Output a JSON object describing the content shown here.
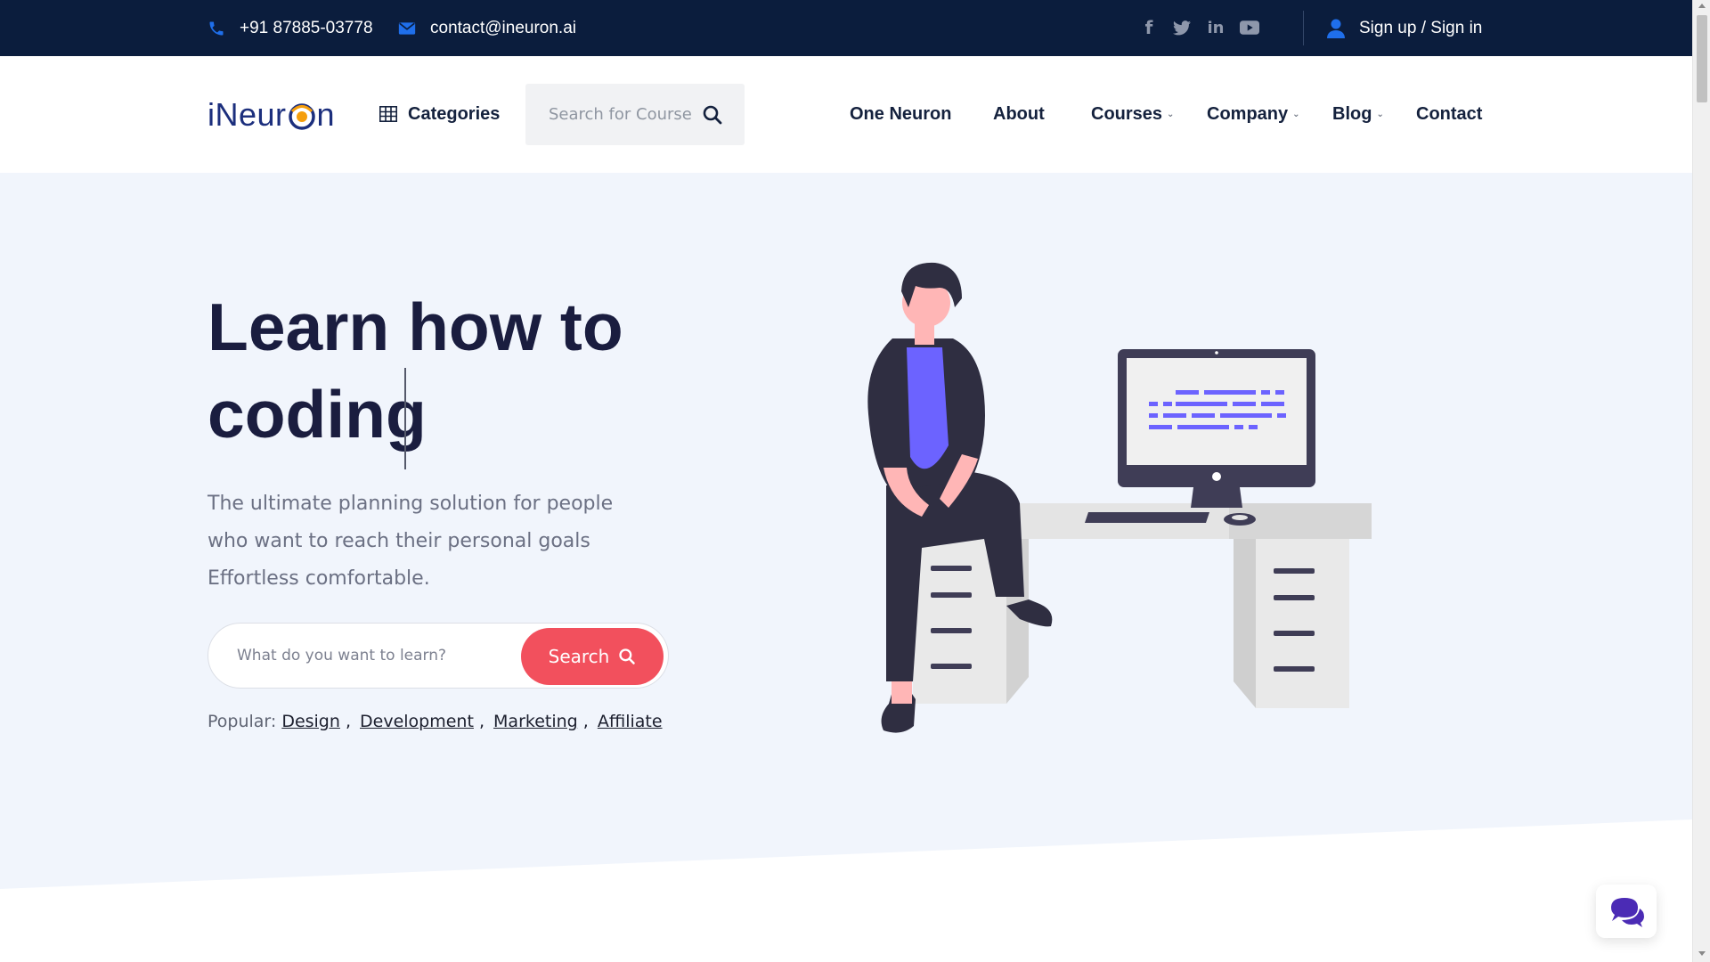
{
  "topbar": {
    "phone": "+91 87885-03778",
    "email": "contact@ineuron.ai",
    "social": [
      {
        "icon": "facebook-icon",
        "glyph": "f"
      },
      {
        "icon": "twitter-icon",
        "glyph": "t"
      },
      {
        "icon": "linkedin-icon",
        "glyph": "in"
      },
      {
        "icon": "youtube-icon",
        "glyph": "▶"
      }
    ],
    "sign_in": "Sign up / Sign in"
  },
  "header": {
    "logo_text_a": "iNeur",
    "logo_text_b": "n",
    "categories": "Categories",
    "search_placeholder": "Search for Course",
    "nav": [
      {
        "label": "One Neuron",
        "dropdown": false
      },
      {
        "label": "About",
        "dropdown": false
      },
      {
        "label": "Courses",
        "dropdown": true
      },
      {
        "label": "Company",
        "dropdown": true
      },
      {
        "label": "Blog",
        "dropdown": true
      },
      {
        "label": "Contact",
        "dropdown": false
      }
    ]
  },
  "hero": {
    "headline_line1": "Learn how to",
    "headline_line2": "coding",
    "subtext": "The ultimate planning solution for people who want to reach their personal goals Effortless comfortable.",
    "search_placeholder": "What do you want to learn?",
    "search_button": "Search",
    "popular_label": "Popular:",
    "popular_tags": [
      "Design",
      "Development",
      "Marketing",
      "Affiliate"
    ]
  },
  "colors": {
    "topbar_bg": "#0b1d3d",
    "brand_blue": "#1c2f7d",
    "accent_red": "#f2505d",
    "hero_bg": "#f1f5fc",
    "illustration_purple": "#6c63ff"
  }
}
